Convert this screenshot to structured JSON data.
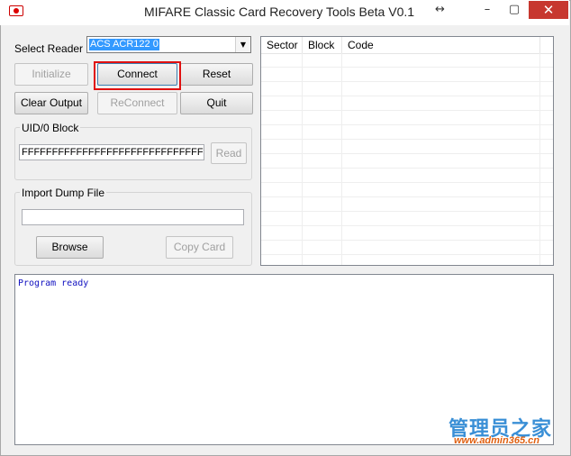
{
  "window": {
    "title": "MIFARE Classic Card Recovery Tools Beta V0.1",
    "resize_glyph": "↔",
    "minimize": "–",
    "maximize": "▢",
    "close": "✕"
  },
  "reader": {
    "label": "Select Reader",
    "selected": "ACS ACR122 0",
    "arrow": "▼"
  },
  "buttons": {
    "initialize": "Initialize",
    "connect": "Connect",
    "reset": "Reset",
    "clear_output": "Clear Output",
    "reconnect": "ReConnect",
    "quit": "Quit",
    "read": "Read",
    "browse": "Browse",
    "copy_card": "Copy Card"
  },
  "uid_group": {
    "title": "UID/0 Block",
    "value": "FFFFFFFFFFFFFFFFFFFFFFFFFFFFFFFF"
  },
  "import_group": {
    "title": "Import Dump File",
    "value": ""
  },
  "table": {
    "columns": [
      "Sector",
      "Block",
      "Code"
    ]
  },
  "output": {
    "text": "Program ready"
  },
  "watermark": {
    "main": "管理员之家",
    "url": "www.admin365.cn"
  },
  "colors": {
    "highlight": "#e01010",
    "output_text": "#1010c0",
    "selection": "#3399ff",
    "close_button": "#c7372f"
  }
}
